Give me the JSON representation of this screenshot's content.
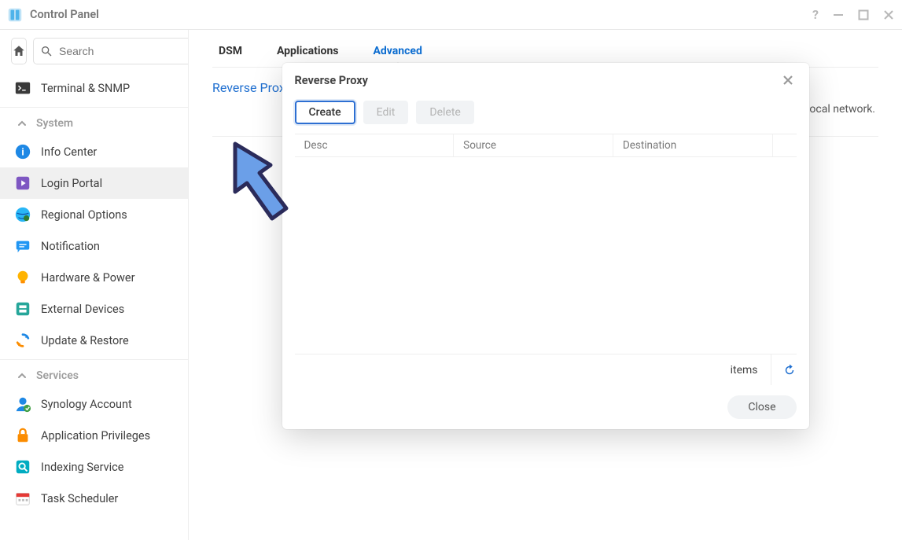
{
  "window": {
    "title": "Control Panel"
  },
  "search": {
    "placeholder": "Search"
  },
  "sidebar": {
    "topItem": {
      "label": "Terminal & SNMP"
    },
    "sections": [
      {
        "header": "System",
        "items": [
          {
            "label": "Info Center"
          },
          {
            "label": "Login Portal"
          },
          {
            "label": "Regional Options"
          },
          {
            "label": "Notification"
          },
          {
            "label": "Hardware & Power"
          },
          {
            "label": "External Devices"
          },
          {
            "label": "Update & Restore"
          }
        ]
      },
      {
        "header": "Services",
        "items": [
          {
            "label": "Synology Account"
          },
          {
            "label": "Application Privileges"
          },
          {
            "label": "Indexing Service"
          },
          {
            "label": "Task Scheduler"
          }
        ]
      }
    ]
  },
  "tabs": {
    "dsm": "DSM",
    "applications": "Applications",
    "advanced": "Advanced"
  },
  "page": {
    "sectionTitle": "Reverse Proxy",
    "sectionDescTail": "evices in the local network."
  },
  "dialog": {
    "title": "Reverse Proxy",
    "buttons": {
      "create": "Create",
      "edit": "Edit",
      "delete": "Delete"
    },
    "columns": {
      "description": "Description",
      "source": "Source",
      "destination": "Destination"
    },
    "descriptionVisible": "Desc",
    "status": "items",
    "close": "Close"
  }
}
